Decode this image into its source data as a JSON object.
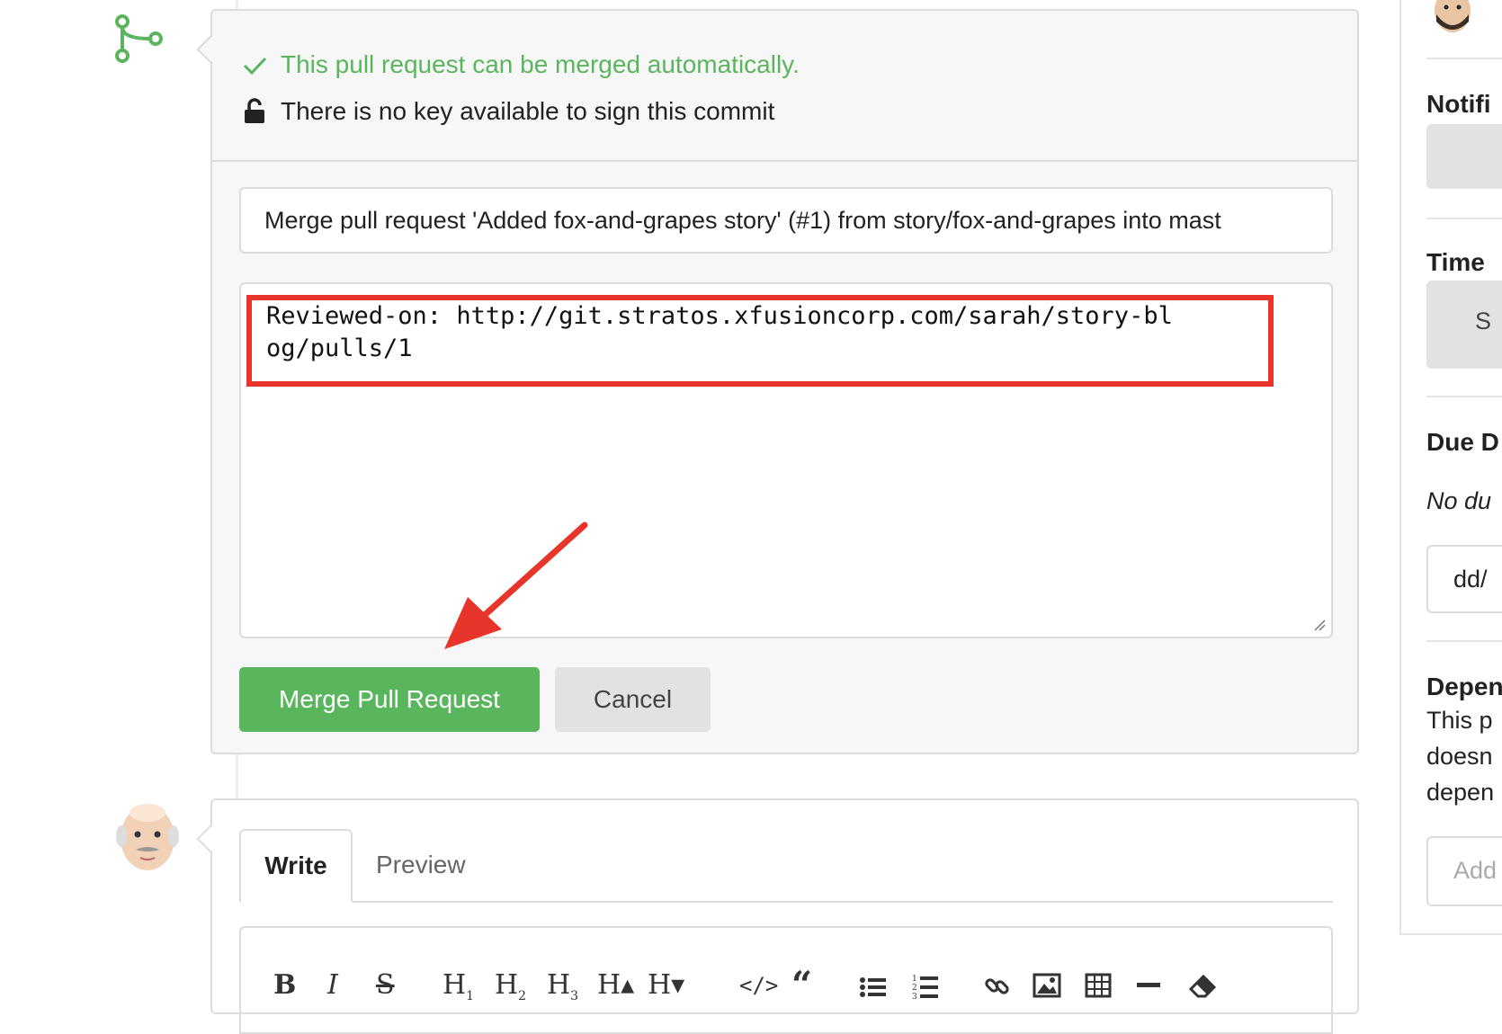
{
  "merge_panel": {
    "status_ok": "This pull request can be merged automatically.",
    "status_signing": "There is no key available to sign this commit",
    "commit_title": "Merge pull request 'Added fox-and-grapes story' (#1) from story/fox-and-grapes into mast",
    "commit_message": "Reviewed-on: http://git.stratos.xfusioncorp.com/sarah/story-blog/pulls/1",
    "merge_button": "Merge Pull Request",
    "cancel_button": "Cancel"
  },
  "comment": {
    "tabs": [
      "Write",
      "Preview"
    ],
    "toolbar": [
      "B",
      "I",
      "S",
      "H1",
      "H2",
      "H3",
      "H▴",
      "H▾",
      "</>",
      "“",
      "list",
      "numbered-list",
      "link",
      "image",
      "table",
      "hr",
      "eraser"
    ]
  },
  "sidebar": {
    "notifications_heading": "Notifi",
    "time_heading": "Time",
    "time_button": "S",
    "due_heading": "Due D",
    "due_none": "No du",
    "due_placeholder": "dd/",
    "dependencies_heading": "Depen",
    "dependencies_text_1": "This p",
    "dependencies_text_2": "doesn",
    "dependencies_text_3": "depen",
    "add_placeholder": "Add"
  },
  "colors": {
    "success_green": "#5bb55f",
    "merge_button": "#59b65c",
    "annotation_red": "#e8352b"
  }
}
